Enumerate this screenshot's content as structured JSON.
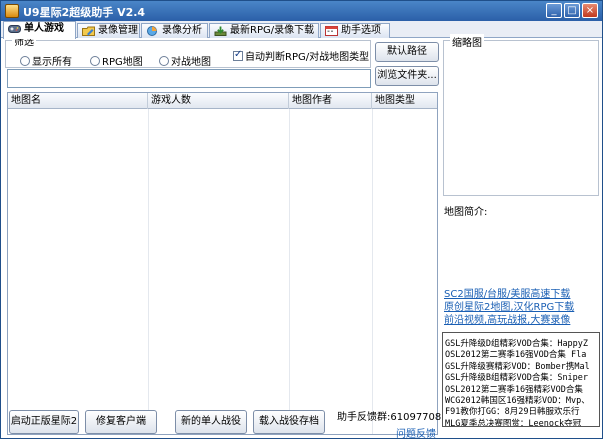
{
  "window": {
    "title": "U9星际2超级助手 V2.4",
    "controls": {
      "minimize": "_",
      "maximize": "□",
      "close": "×"
    }
  },
  "tabs": [
    {
      "label": "单人游戏",
      "icon": "gamepad-icon",
      "active": true
    },
    {
      "label": "录像管理",
      "icon": "folder-edit-icon",
      "active": false
    },
    {
      "label": "录像分析",
      "icon": "pie-chart-icon",
      "active": false
    },
    {
      "label": "最新RPG/录像下载",
      "icon": "download-icon",
      "active": false
    },
    {
      "label": "助手选项",
      "icon": "calendar-icon",
      "active": false
    }
  ],
  "filter": {
    "title": "筛选",
    "options": [
      {
        "label": "显示所有",
        "selected": false
      },
      {
        "label": "RPG地图",
        "selected": false
      },
      {
        "label": "对战地图",
        "selected": false
      }
    ],
    "auto_detect": {
      "label": "自动判断RPG/对战地图类型",
      "checked": true
    }
  },
  "buttons": {
    "default_path": "默认路径",
    "browse": "浏览文件夹...",
    "launch_sc2": "启动正版星际2",
    "repair_client": "修复客户端",
    "new_campaign": "新的单人战役",
    "load_campaign": "载入战役存档"
  },
  "path_input": {
    "value": "",
    "placeholder": ""
  },
  "table": {
    "columns": [
      "地图名",
      "游戏人数",
      "地图作者",
      "地图类型"
    ],
    "rows": []
  },
  "thumbnail": {
    "title": "缩略图"
  },
  "map_description": {
    "label": "地图简介:"
  },
  "links": [
    "SC2国服/台服/美服高速下载",
    "原创星际2地图,汉化RPG下载",
    "前沿视频,高玩战报,大赛录像"
  ],
  "news": [
    "GSL升降级D组精彩VOD合集：HappyZ",
    "OSL2012第二赛季16强VOD合集 Fla",
    "GSL升降级赛精彩VOD：Bomber携Mal",
    "GSL升降级B组精彩VOD合集：Sniper",
    "OSL2012第二赛季16强精彩VOD合集",
    "WCG2012韩国区16强精彩VOD：Mvp、",
    "F91教你打GG：8月29日韩服欢乐行",
    "MLG夏季总决赛图赏：Leenock夺冠"
  ],
  "feedback": {
    "qq_group": "助手反馈群:61097708",
    "link": "问题反馈"
  }
}
